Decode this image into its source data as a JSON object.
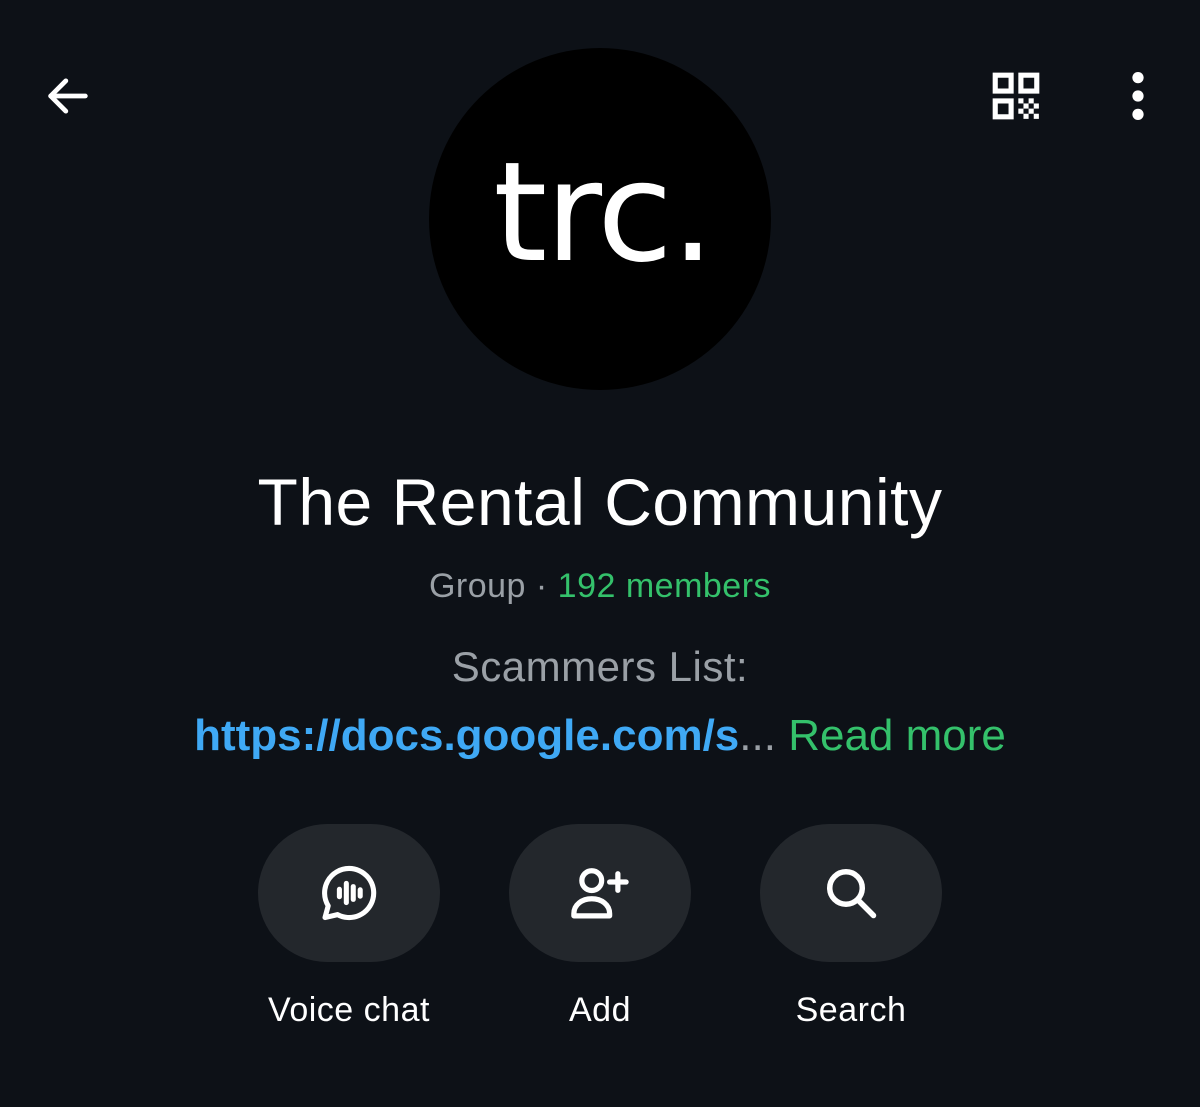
{
  "header": {
    "back_icon": "arrow-left-icon",
    "qr_icon": "qr-code-icon",
    "more_icon": "more-vertical-icon"
  },
  "avatar": {
    "text": "trc.",
    "background": "#000000"
  },
  "group": {
    "title": "The Rental Community",
    "type": "Group",
    "separator": "·",
    "members": "192 members"
  },
  "description": {
    "line1": "Scammers List:",
    "link": "https://docs.google.com/s",
    "ellipsis": "...",
    "read_more": "Read more"
  },
  "actions": [
    {
      "label": "Voice chat",
      "icon": "voice-chat-icon"
    },
    {
      "label": "Add",
      "icon": "add-user-icon"
    },
    {
      "label": "Search",
      "icon": "search-icon"
    }
  ],
  "colors": {
    "background": "#0d1117",
    "button_bg": "#23272c",
    "accent_green": "#34c16b",
    "link_blue": "#3fa9f5",
    "muted_text": "#9aa0a6"
  }
}
